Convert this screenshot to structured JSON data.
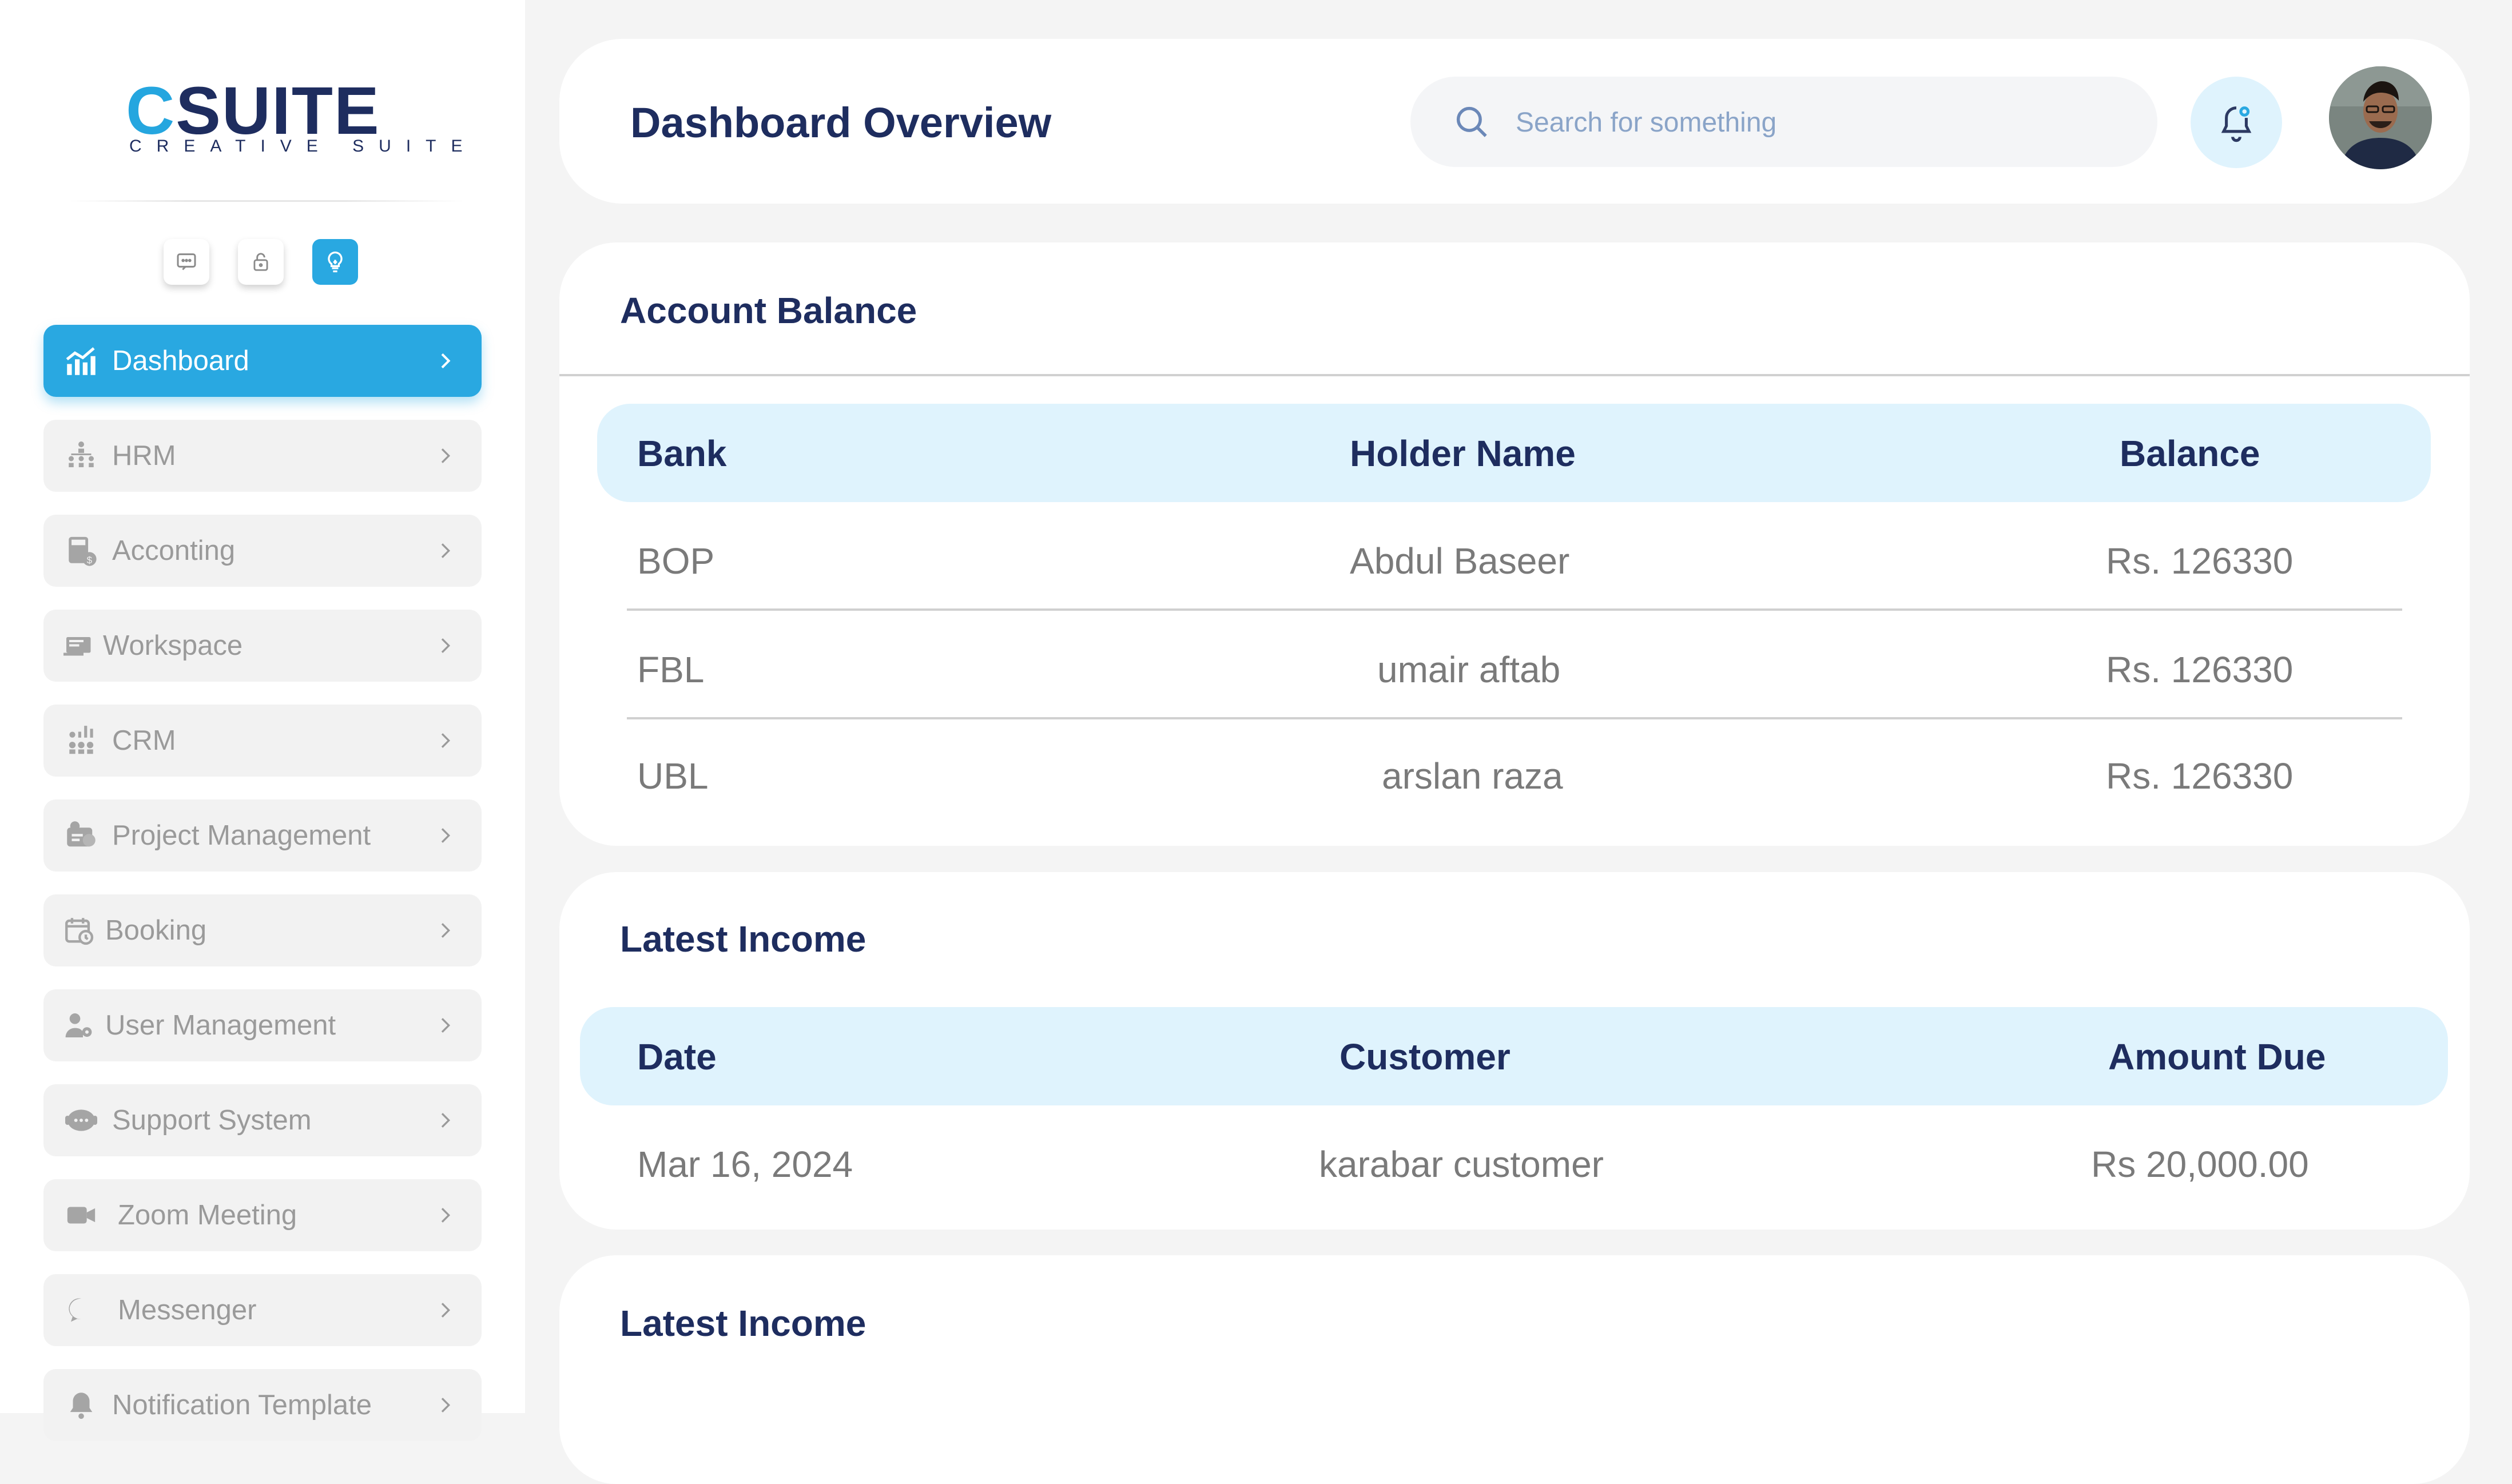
{
  "brand": {
    "logo_text": "CSUITE",
    "tagline": "CREATIVE SUITE"
  },
  "quick_icons": [
    "chat-icon",
    "lock-icon",
    "lightbulb-icon"
  ],
  "sidebar": {
    "items": [
      {
        "label": "Dashboard",
        "icon": "chart-bars-icon",
        "active": true
      },
      {
        "label": "HRM",
        "icon": "org-chart-icon"
      },
      {
        "label": "Acconting",
        "icon": "calculator-icon"
      },
      {
        "label": "Workspace",
        "icon": "workspace-icon"
      },
      {
        "label": "CRM",
        "icon": "crm-icon"
      },
      {
        "label": "Project Management",
        "icon": "project-icon"
      },
      {
        "label": "Booking",
        "icon": "calendar-clock-icon"
      },
      {
        "label": "User Management",
        "icon": "user-gear-icon"
      },
      {
        "label": "Support System",
        "icon": "support-chat-icon"
      },
      {
        "label": "Zoom Meeting",
        "icon": "video-camera-icon"
      },
      {
        "label": "Messenger",
        "icon": "message-bubble-icon"
      },
      {
        "label": "Notification Template",
        "icon": "bell-icon"
      }
    ]
  },
  "header": {
    "title": "Dashboard Overview",
    "search_placeholder": "Search for something"
  },
  "account_balance": {
    "title": "Account Balance",
    "columns": [
      "Bank",
      "Holder Name",
      "Balance"
    ],
    "rows": [
      [
        "BOP",
        "Abdul Baseer",
        "Rs. 126330"
      ],
      [
        "FBL",
        "umair aftab",
        "Rs. 126330"
      ],
      [
        "UBL",
        "arslan raza",
        "Rs. 126330"
      ]
    ]
  },
  "latest_income": {
    "title": "Latest Income",
    "columns": [
      "Date",
      "Customer",
      "Amount Due"
    ],
    "rows": [
      [
        "Mar 16, 2024",
        "karabar customer",
        "Rs 20,000.00"
      ]
    ]
  },
  "latest_income_2": {
    "title": "Latest Income"
  },
  "colors": {
    "accent": "#29a8e1",
    "navy": "#1e2d5f",
    "table_header_bg": "#dff3fd"
  }
}
